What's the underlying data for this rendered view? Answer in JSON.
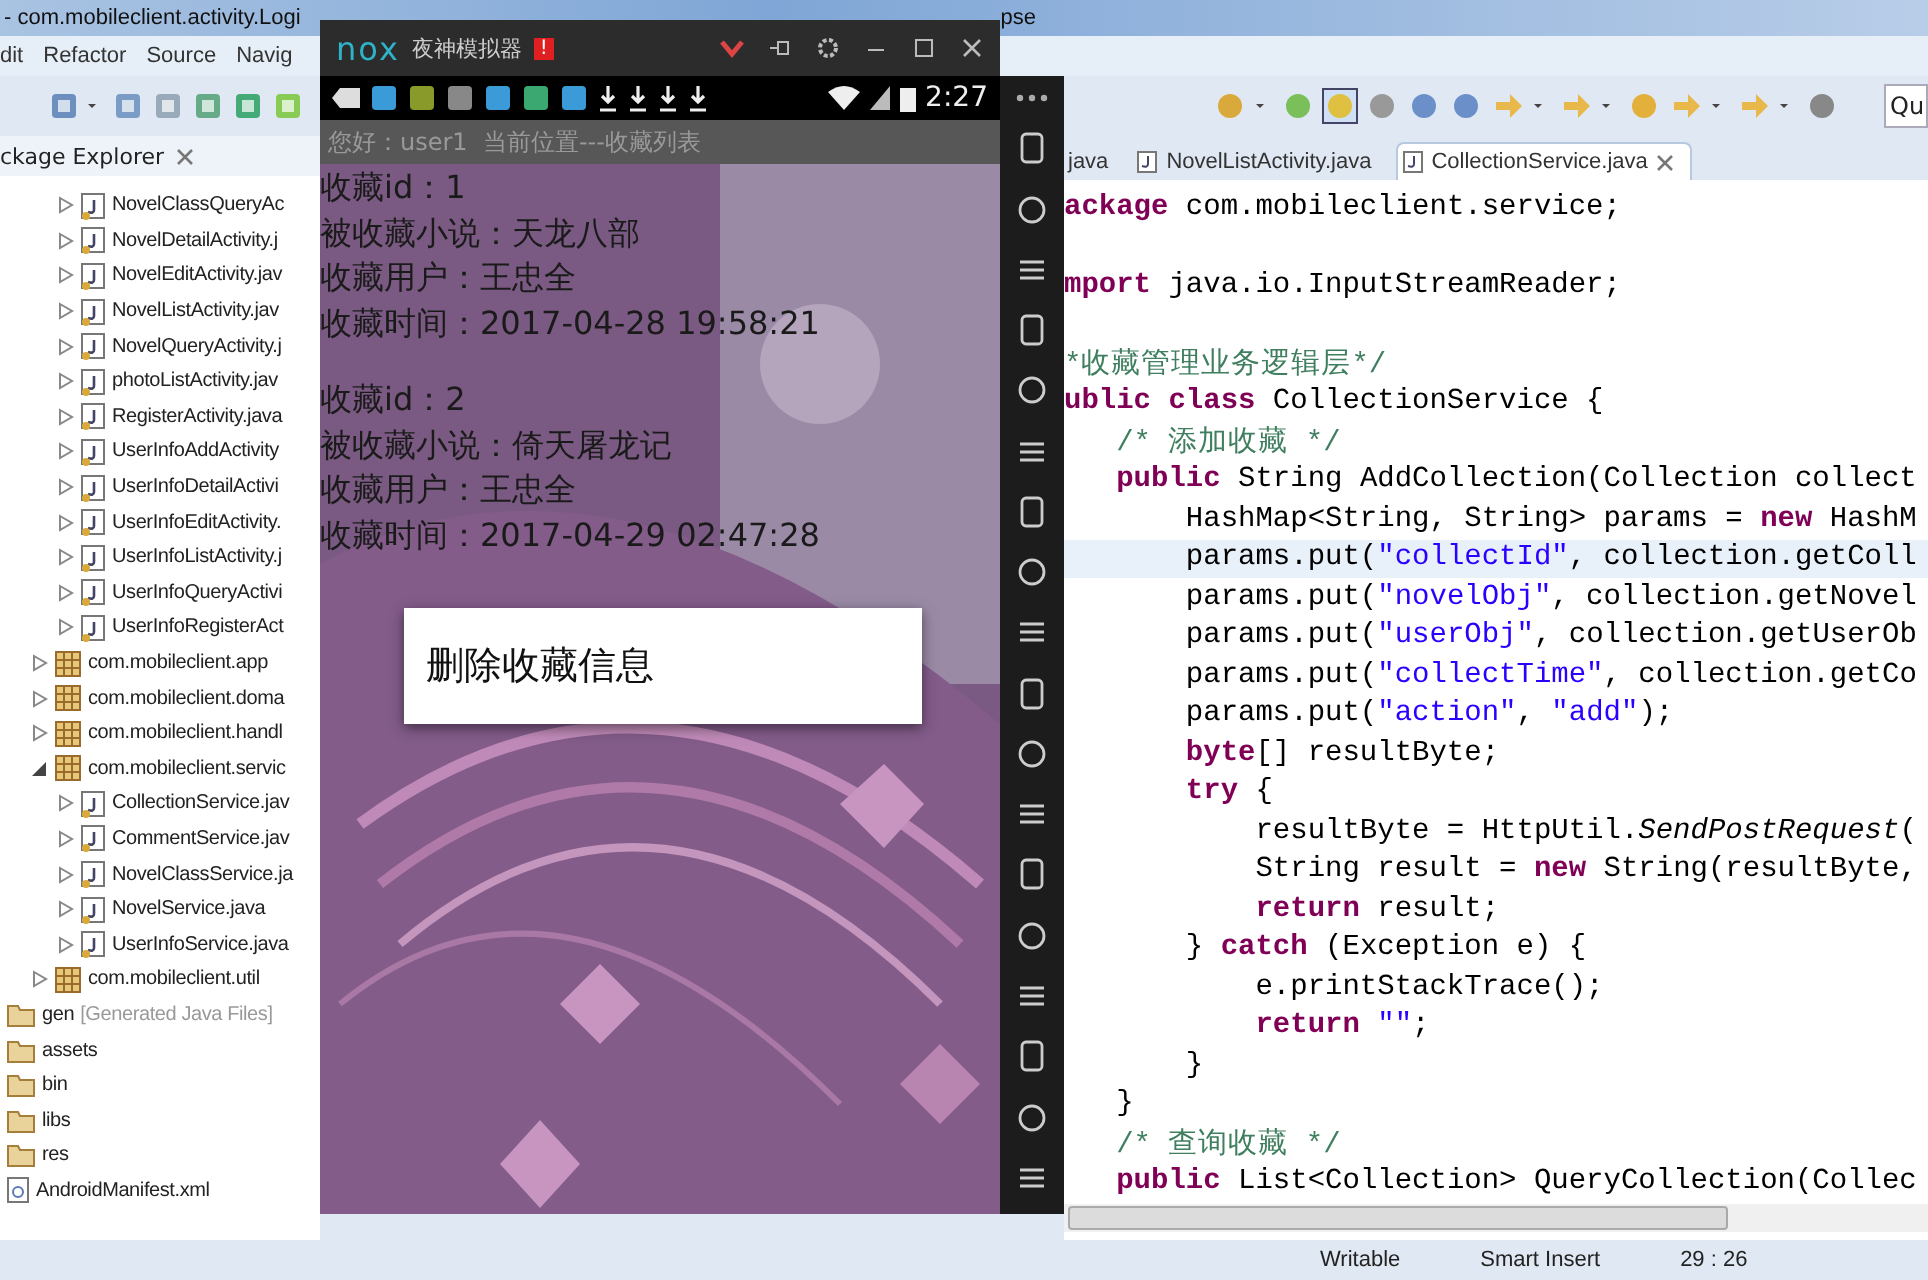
{
  "eclipse": {
    "title": "- com.mobileclient.activity.Logi",
    "title_end": "pse",
    "menu": [
      "dit",
      "Refactor",
      "Source",
      "Navig"
    ],
    "quick_access": {
      "placeholder": "Qu"
    },
    "explorer": {
      "title": "ckage Explorer",
      "tree": [
        {
          "children": [
            {
              "children": [
                {
                  "kind": "file",
                  "label": "NovelClassQueryAc",
                  "expanded": false
                },
                {
                  "kind": "file",
                  "label": "NovelDetailActivity.j",
                  "expanded": false
                },
                {
                  "kind": "file",
                  "label": "NovelEditActivity.jav",
                  "expanded": false
                },
                {
                  "kind": "file",
                  "label": "NovelListActivity.jav",
                  "expanded": false
                },
                {
                  "kind": "file",
                  "label": "NovelQueryActivity.j",
                  "expanded": false
                },
                {
                  "kind": "file",
                  "label": "photoListActivity.jav",
                  "expanded": false
                },
                {
                  "kind": "file",
                  "label": "RegisterActivity.java",
                  "expanded": false
                },
                {
                  "kind": "file",
                  "label": "UserInfoAddActivity",
                  "expanded": false
                },
                {
                  "kind": "file",
                  "label": "UserInfoDetailActivi",
                  "expanded": false
                },
                {
                  "kind": "file",
                  "label": "UserInfoEditActivity.",
                  "expanded": false
                },
                {
                  "kind": "file",
                  "label": "UserInfoListActivity.j",
                  "expanded": false
                },
                {
                  "kind": "file",
                  "label": "UserInfoQueryActivi",
                  "expanded": false
                },
                {
                  "kind": "file",
                  "label": "UserInfoRegisterAct",
                  "expanded": false
                }
              ]
            },
            {
              "kind": "package",
              "label": "com.mobileclient.app",
              "expanded": false
            },
            {
              "kind": "package",
              "label": "com.mobileclient.doma",
              "expanded": false
            },
            {
              "kind": "package",
              "label": "com.mobileclient.handl",
              "expanded": false
            },
            {
              "kind": "package",
              "label": "com.mobileclient.servic",
              "expanded": true,
              "children": [
                {
                  "kind": "file",
                  "label": "CollectionService.jav",
                  "expanded": false
                },
                {
                  "kind": "file",
                  "label": "CommentService.jav",
                  "expanded": false
                },
                {
                  "kind": "file",
                  "label": "NovelClassService.ja",
                  "expanded": false
                },
                {
                  "kind": "file",
                  "label": "NovelService.java",
                  "expanded": false
                },
                {
                  "kind": "file",
                  "label": "UserInfoService.java",
                  "expanded": false
                }
              ]
            },
            {
              "kind": "package",
              "label": "com.mobileclient.util",
              "expanded": false
            }
          ]
        },
        {
          "kind": "folder",
          "label": "gen",
          "note": "[Generated Java Files]"
        },
        {
          "kind": "folder",
          "label": "assets"
        },
        {
          "kind": "folder",
          "label": "bin"
        },
        {
          "kind": "folder",
          "label": "libs"
        },
        {
          "kind": "folder",
          "label": "res"
        },
        {
          "kind": "xml",
          "label": "AndroidManifest.xml"
        }
      ]
    },
    "tabs": [
      {
        "label": "java",
        "selected": false
      },
      {
        "label": "NovelListActivity.java",
        "selected": false
      },
      {
        "label": "CollectionService.java",
        "selected": true
      }
    ],
    "code": [
      {
        "current": false,
        "tokens": [
          {
            "kind": "kw",
            "text": "ackage"
          },
          {
            "kind": "plain",
            "text": " com.mobileclient.service;"
          }
        ]
      },
      {
        "current": false
      },
      {
        "current": false,
        "tokens": [
          {
            "kind": "kw",
            "text": "mport"
          },
          {
            "kind": "plain",
            "text": " java.io.InputStreamReader;"
          }
        ]
      },
      {
        "current": false
      },
      {
        "current": false,
        "tokens": [
          {
            "kind": "com",
            "text": "*收藏管理业务逻辑层*/"
          }
        ]
      },
      {
        "current": false,
        "tokens": [
          {
            "kind": "kw",
            "text": "ublic class"
          },
          {
            "kind": "plain",
            "text": " CollectionService {"
          }
        ]
      },
      {
        "current": false,
        "tokens": [
          {
            "kind": "com",
            "text": "   /* 添加收藏 */"
          }
        ]
      },
      {
        "current": false,
        "tokens": [
          {
            "kind": "kw",
            "text": "   public"
          },
          {
            "kind": "plain",
            "text": " String AddCollection(Collection collect"
          }
        ]
      },
      {
        "current": false,
        "tokens": [
          {
            "kind": "plain",
            "text": "       HashMap<String, String> params = "
          },
          {
            "kind": "kw",
            "text": "new"
          },
          {
            "kind": "plain",
            "text": " HashM"
          }
        ]
      },
      {
        "current": true,
        "tokens": [
          {
            "kind": "plain",
            "text": "       params.put("
          },
          {
            "kind": "str",
            "text": "\"collectId\""
          },
          {
            "kind": "plain",
            "text": ", collection.getColl"
          }
        ]
      },
      {
        "current": false,
        "tokens": [
          {
            "kind": "plain",
            "text": "       params.put("
          },
          {
            "kind": "str",
            "text": "\"novelObj\""
          },
          {
            "kind": "plain",
            "text": ", collection.getNovel"
          }
        ]
      },
      {
        "current": false,
        "tokens": [
          {
            "kind": "plain",
            "text": "       params.put("
          },
          {
            "kind": "str",
            "text": "\"userObj\""
          },
          {
            "kind": "plain",
            "text": ", collection.getUserOb"
          }
        ]
      },
      {
        "current": false,
        "tokens": [
          {
            "kind": "plain",
            "text": "       params.put("
          },
          {
            "kind": "str",
            "text": "\"collectTime\""
          },
          {
            "kind": "plain",
            "text": ", collection.getCo"
          }
        ]
      },
      {
        "current": false,
        "tokens": [
          {
            "kind": "plain",
            "text": "       params.put("
          },
          {
            "kind": "str",
            "text": "\"action\""
          },
          {
            "kind": "plain",
            "text": ", "
          },
          {
            "kind": "str",
            "text": "\"add\""
          },
          {
            "kind": "plain",
            "text": ");"
          }
        ]
      },
      {
        "current": false,
        "tokens": [
          {
            "kind": "kw",
            "text": "       byte"
          },
          {
            "kind": "plain",
            "text": "[] resultByte;"
          }
        ]
      },
      {
        "current": false,
        "tokens": [
          {
            "kind": "kw",
            "text": "       try"
          },
          {
            "kind": "plain",
            "text": " {"
          }
        ]
      },
      {
        "current": false,
        "tokens": [
          {
            "kind": "plain",
            "text": "           resultByte = HttpUtil."
          },
          {
            "kind": "ital",
            "text": "SendPostRequest"
          },
          {
            "kind": "plain",
            "text": "("
          }
        ]
      },
      {
        "current": false,
        "tokens": [
          {
            "kind": "plain",
            "text": "           String result = "
          },
          {
            "kind": "kw",
            "text": "new"
          },
          {
            "kind": "plain",
            "text": " String(resultByte,"
          }
        ]
      },
      {
        "current": false,
        "tokens": [
          {
            "kind": "kw",
            "text": "           return"
          },
          {
            "kind": "plain",
            "text": " result;"
          }
        ]
      },
      {
        "current": false,
        "tokens": [
          {
            "kind": "plain",
            "text": "       } "
          },
          {
            "kind": "kw",
            "text": "catch"
          },
          {
            "kind": "plain",
            "text": " (Exception e) {"
          }
        ]
      },
      {
        "current": false,
        "tokens": [
          {
            "kind": "plain",
            "text": "           e.printStackTrace();"
          }
        ]
      },
      {
        "current": false,
        "tokens": [
          {
            "kind": "kw",
            "text": "           return"
          },
          {
            "kind": "str",
            "text": " \"\""
          },
          {
            "kind": "plain",
            "text": ";"
          }
        ]
      },
      {
        "current": false,
        "tokens": [
          {
            "kind": "plain",
            "text": "       }"
          }
        ]
      },
      {
        "current": false,
        "tokens": [
          {
            "kind": "plain",
            "text": "   }"
          }
        ]
      },
      {
        "current": false,
        "tokens": [
          {
            "kind": "com",
            "text": "   /* 查询收藏 */"
          }
        ]
      },
      {
        "current": false,
        "tokens": [
          {
            "kind": "kw",
            "text": "   public"
          },
          {
            "kind": "plain",
            "text": " List<Collection> QueryCollection(Collec"
          }
        ]
      }
    ],
    "status": [
      "Writable",
      "Smart Insert",
      "29 : 26"
    ]
  },
  "emulator": {
    "logo": "nox",
    "title": "夜神模拟器",
    "badge": "!",
    "time": "2:27",
    "header": "您好：user1  当前位置---收藏列表",
    "records": [
      {
        "lines": [
          "收藏id：1",
          "被收藏小说：天龙八部",
          "收藏用户：王忠全",
          "收藏时间：2017-04-28 19:58:21"
        ]
      },
      {
        "lines": [
          "收藏id：2",
          "被收藏小说：倚天屠龙记",
          "收藏用户：王忠全",
          "收藏时间：2017-04-29 02:47:28"
        ]
      }
    ],
    "dialog": "删除收藏信息"
  }
}
